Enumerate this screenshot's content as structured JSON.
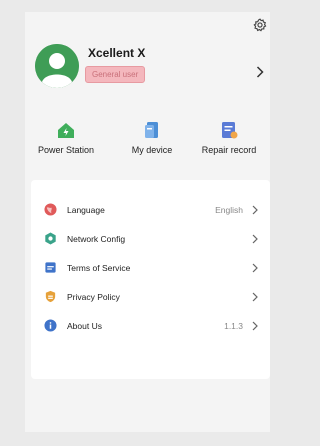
{
  "profile": {
    "name": "Xcellent X",
    "role": "General user"
  },
  "quick_actions": [
    {
      "label": "Power Station",
      "icon": "power-station-icon",
      "color": "#3fae5b"
    },
    {
      "label": "My device",
      "icon": "device-icon",
      "color": "#4d8fd6"
    },
    {
      "label": "Repair record",
      "icon": "repair-record-icon",
      "color": "#5a7bd6"
    }
  ],
  "menu": [
    {
      "label": "Language",
      "value": "English",
      "icon": "globe-icon",
      "color": "#e05a5a"
    },
    {
      "label": "Network Config",
      "value": "",
      "icon": "network-icon",
      "color": "#3aa38a"
    },
    {
      "label": "Terms of Service",
      "value": "",
      "icon": "document-icon",
      "color": "#3f73c9"
    },
    {
      "label": "Privacy Policy",
      "value": "",
      "icon": "shield-icon",
      "color": "#e6a13a"
    },
    {
      "label": "About Us",
      "value": "1.1.3",
      "icon": "info-icon",
      "color": "#3f73c9"
    }
  ],
  "colors": {
    "accent_green": "#3f9d56",
    "badge_bg": "#f4b7bd",
    "badge_text": "#c9707a"
  }
}
